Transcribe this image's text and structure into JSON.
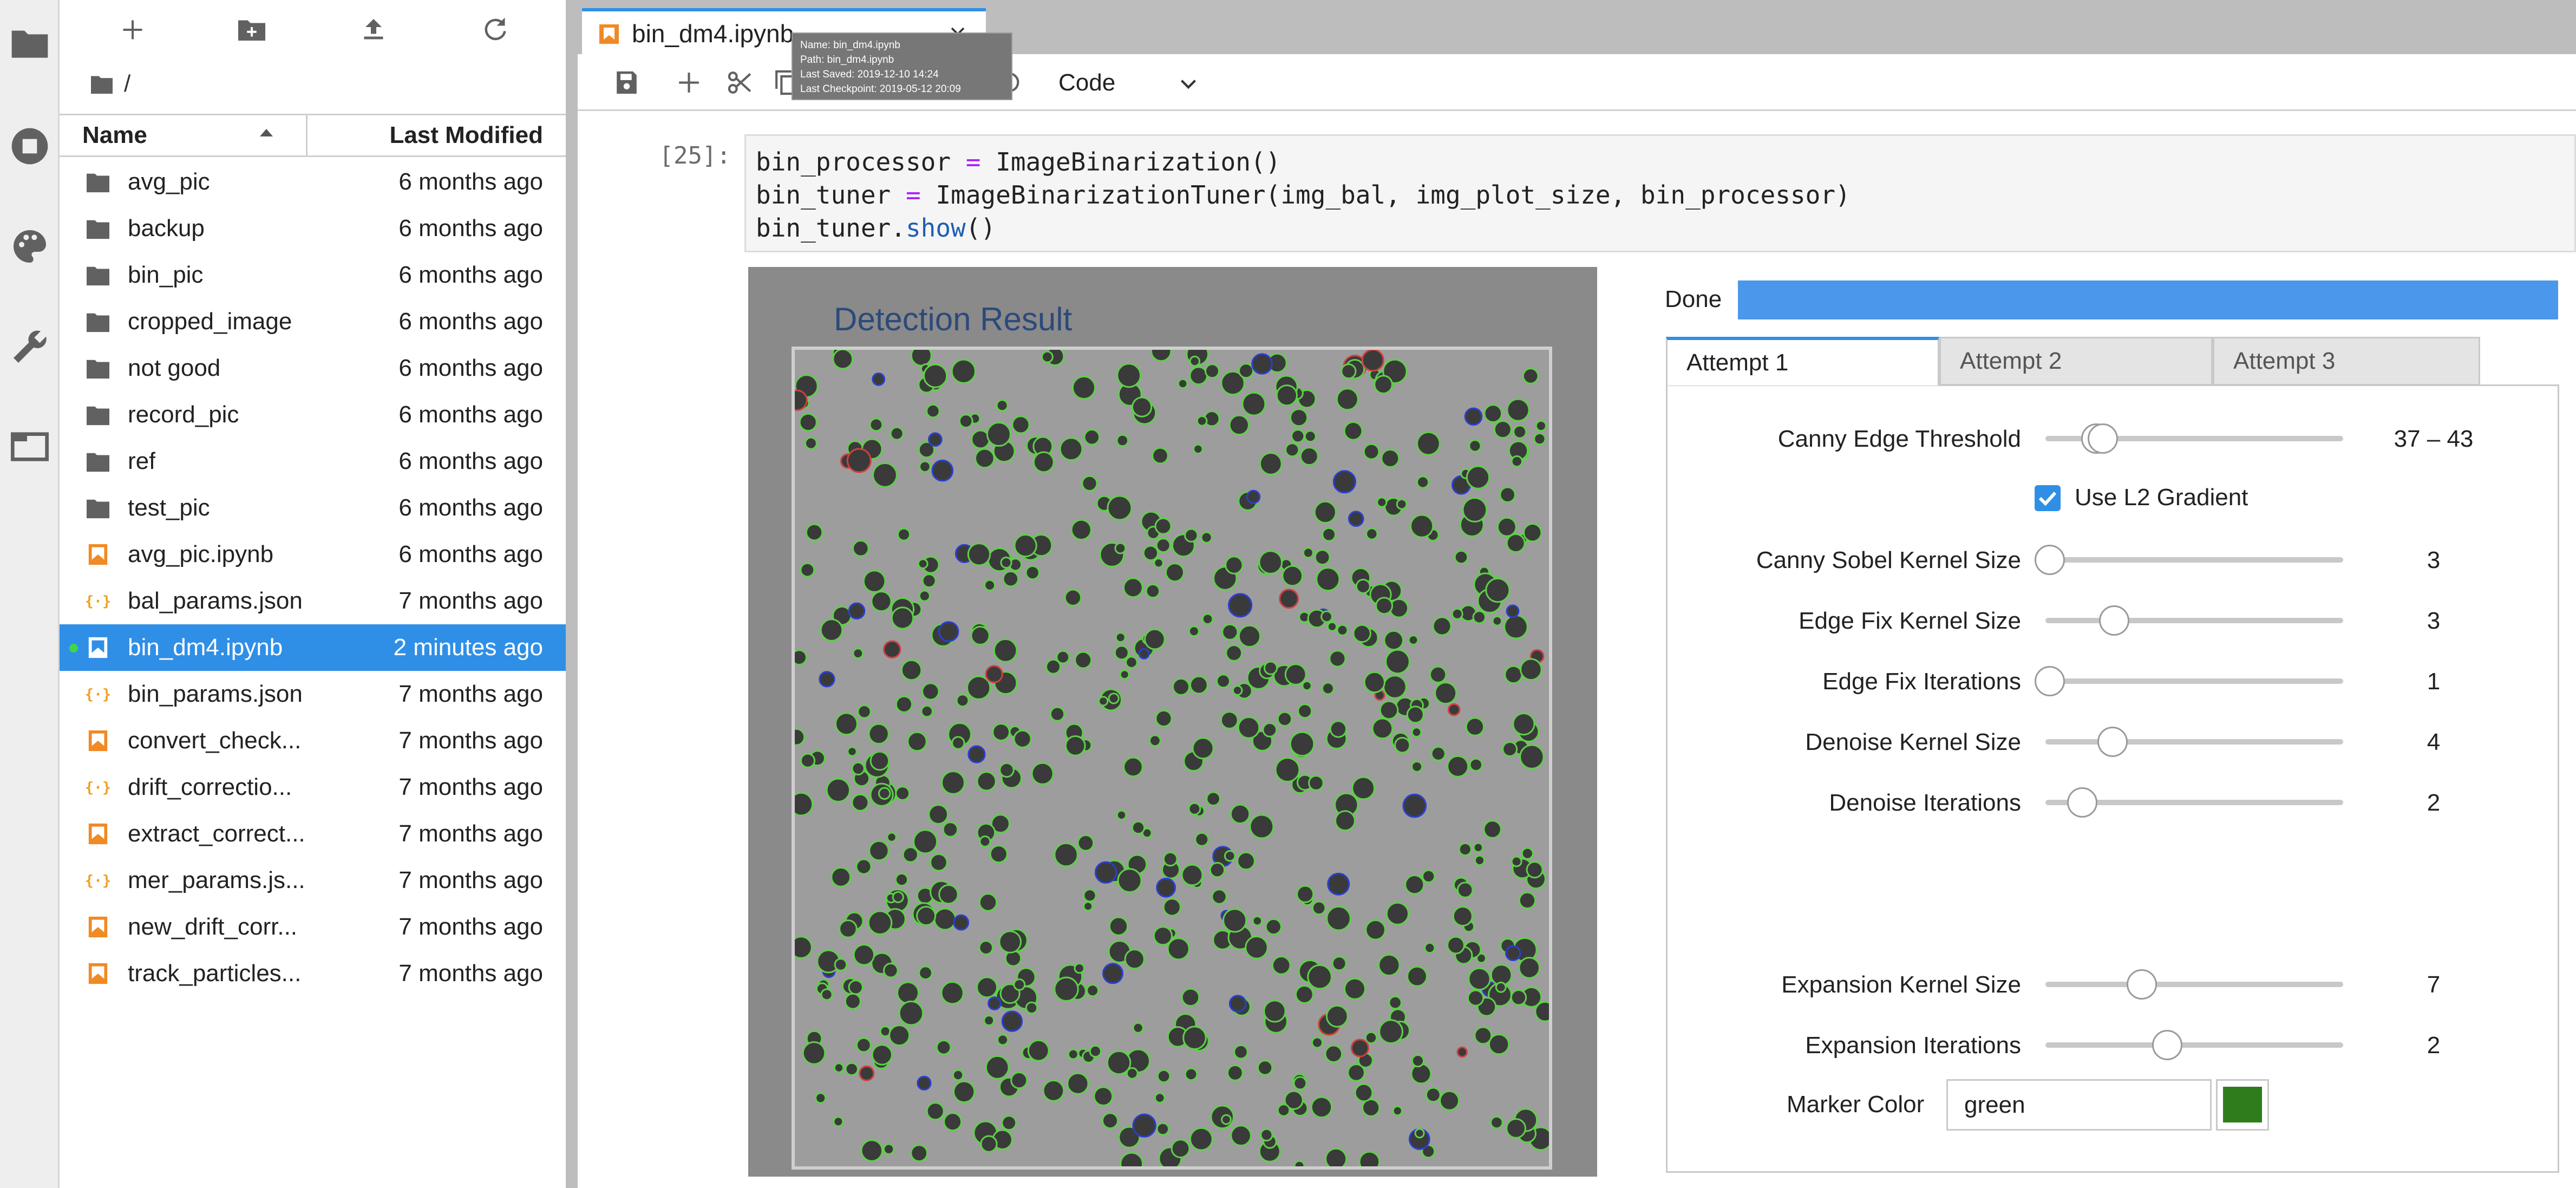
{
  "sidebar": {
    "icons": [
      "folder-icon",
      "running-icon",
      "palette-icon",
      "wrench-icon",
      "tabs-icon"
    ]
  },
  "file_browser": {
    "toolbar": [
      "new-launcher-icon",
      "new-folder-icon",
      "upload-icon",
      "refresh-icon"
    ],
    "breadcrumb": "/",
    "header": {
      "name": "Name",
      "last_modified": "Last Modified"
    },
    "files": [
      {
        "name": "avg_pic",
        "modified": "6 months ago",
        "type": "folder"
      },
      {
        "name": "backup",
        "modified": "6 months ago",
        "type": "folder"
      },
      {
        "name": "bin_pic",
        "modified": "6 months ago",
        "type": "folder"
      },
      {
        "name": "cropped_image",
        "modified": "6 months ago",
        "type": "folder"
      },
      {
        "name": "not good",
        "modified": "6 months ago",
        "type": "folder"
      },
      {
        "name": "record_pic",
        "modified": "6 months ago",
        "type": "folder"
      },
      {
        "name": "ref",
        "modified": "6 months ago",
        "type": "folder"
      },
      {
        "name": "test_pic",
        "modified": "6 months ago",
        "type": "folder"
      },
      {
        "name": "avg_pic.ipynb",
        "modified": "6 months ago",
        "type": "notebook"
      },
      {
        "name": "bal_params.json",
        "modified": "7 months ago",
        "type": "json"
      },
      {
        "name": "bin_dm4.ipynb",
        "modified": "2 minutes ago",
        "type": "notebook",
        "selected": true
      },
      {
        "name": "bin_params.json",
        "modified": "7 months ago",
        "type": "json"
      },
      {
        "name": "convert_check...",
        "modified": "7 months ago",
        "type": "notebook"
      },
      {
        "name": "drift_correctio...",
        "modified": "7 months ago",
        "type": "json"
      },
      {
        "name": "extract_correct...",
        "modified": "7 months ago",
        "type": "notebook"
      },
      {
        "name": "mer_params.js...",
        "modified": "7 months ago",
        "type": "json"
      },
      {
        "name": "new_drift_corr...",
        "modified": "7 months ago",
        "type": "notebook"
      },
      {
        "name": "track_particles...",
        "modified": "7 months ago",
        "type": "notebook"
      }
    ]
  },
  "tab": {
    "label": "bin_dm4.ipynb"
  },
  "tooltip": {
    "name": "Name: bin_dm4.ipynb",
    "path": "Path: bin_dm4.ipynb",
    "saved": "Last Saved: 2019-12-10 14:24",
    "checkpoint": "Last Checkpoint: 2019-05-12 20:09"
  },
  "toolbar": {
    "cell_type": "Code"
  },
  "cell": {
    "prompt": "[25]:",
    "line1": {
      "a": "bin_processor ",
      "op": "=",
      "b": " ImageBinarization()"
    },
    "line2": {
      "a": "bin_tuner ",
      "op": "=",
      "b": " ImageBinarizationTuner(img_bal, img_plot_size, bin_processor)"
    },
    "line3": {
      "a": "bin_tuner.",
      "fn": "show",
      "b": "()"
    }
  },
  "figure": {
    "title": "Detection Result"
  },
  "widget": {
    "progress_label": "Done",
    "progress": 1.0,
    "tabs": [
      "Attempt 1",
      "Attempt 2",
      "Attempt 3"
    ],
    "active_tab": 0,
    "sliders": [
      {
        "label": "Canny Edge Threshold",
        "value": "37 – 43"
      },
      {
        "label": "Canny Sobel Kernel Size",
        "value": "3"
      },
      {
        "label": "Edge Fix Kernel Size",
        "value": "3"
      },
      {
        "label": "Edge Fix Iterations",
        "value": "1"
      },
      {
        "label": "Denoise Kernel Size",
        "value": "4"
      },
      {
        "label": "Denoise Iterations",
        "value": "2"
      },
      {
        "label": "Expansion Kernel Size",
        "value": "7"
      },
      {
        "label": "Expansion Iterations",
        "value": "2"
      }
    ],
    "use_l2_gradient": {
      "label": "Use L2 Gradient",
      "checked": true
    },
    "marker_color": {
      "label": "Marker Color",
      "value": "green",
      "swatch": "#2e7d1d"
    }
  },
  "colors": {
    "accent": "#2f8fe6",
    "progress": "#4a97ec",
    "notebook_icon": "#f08a24",
    "json_icon": "#f0a020",
    "running_dot": "#3fd64b"
  }
}
